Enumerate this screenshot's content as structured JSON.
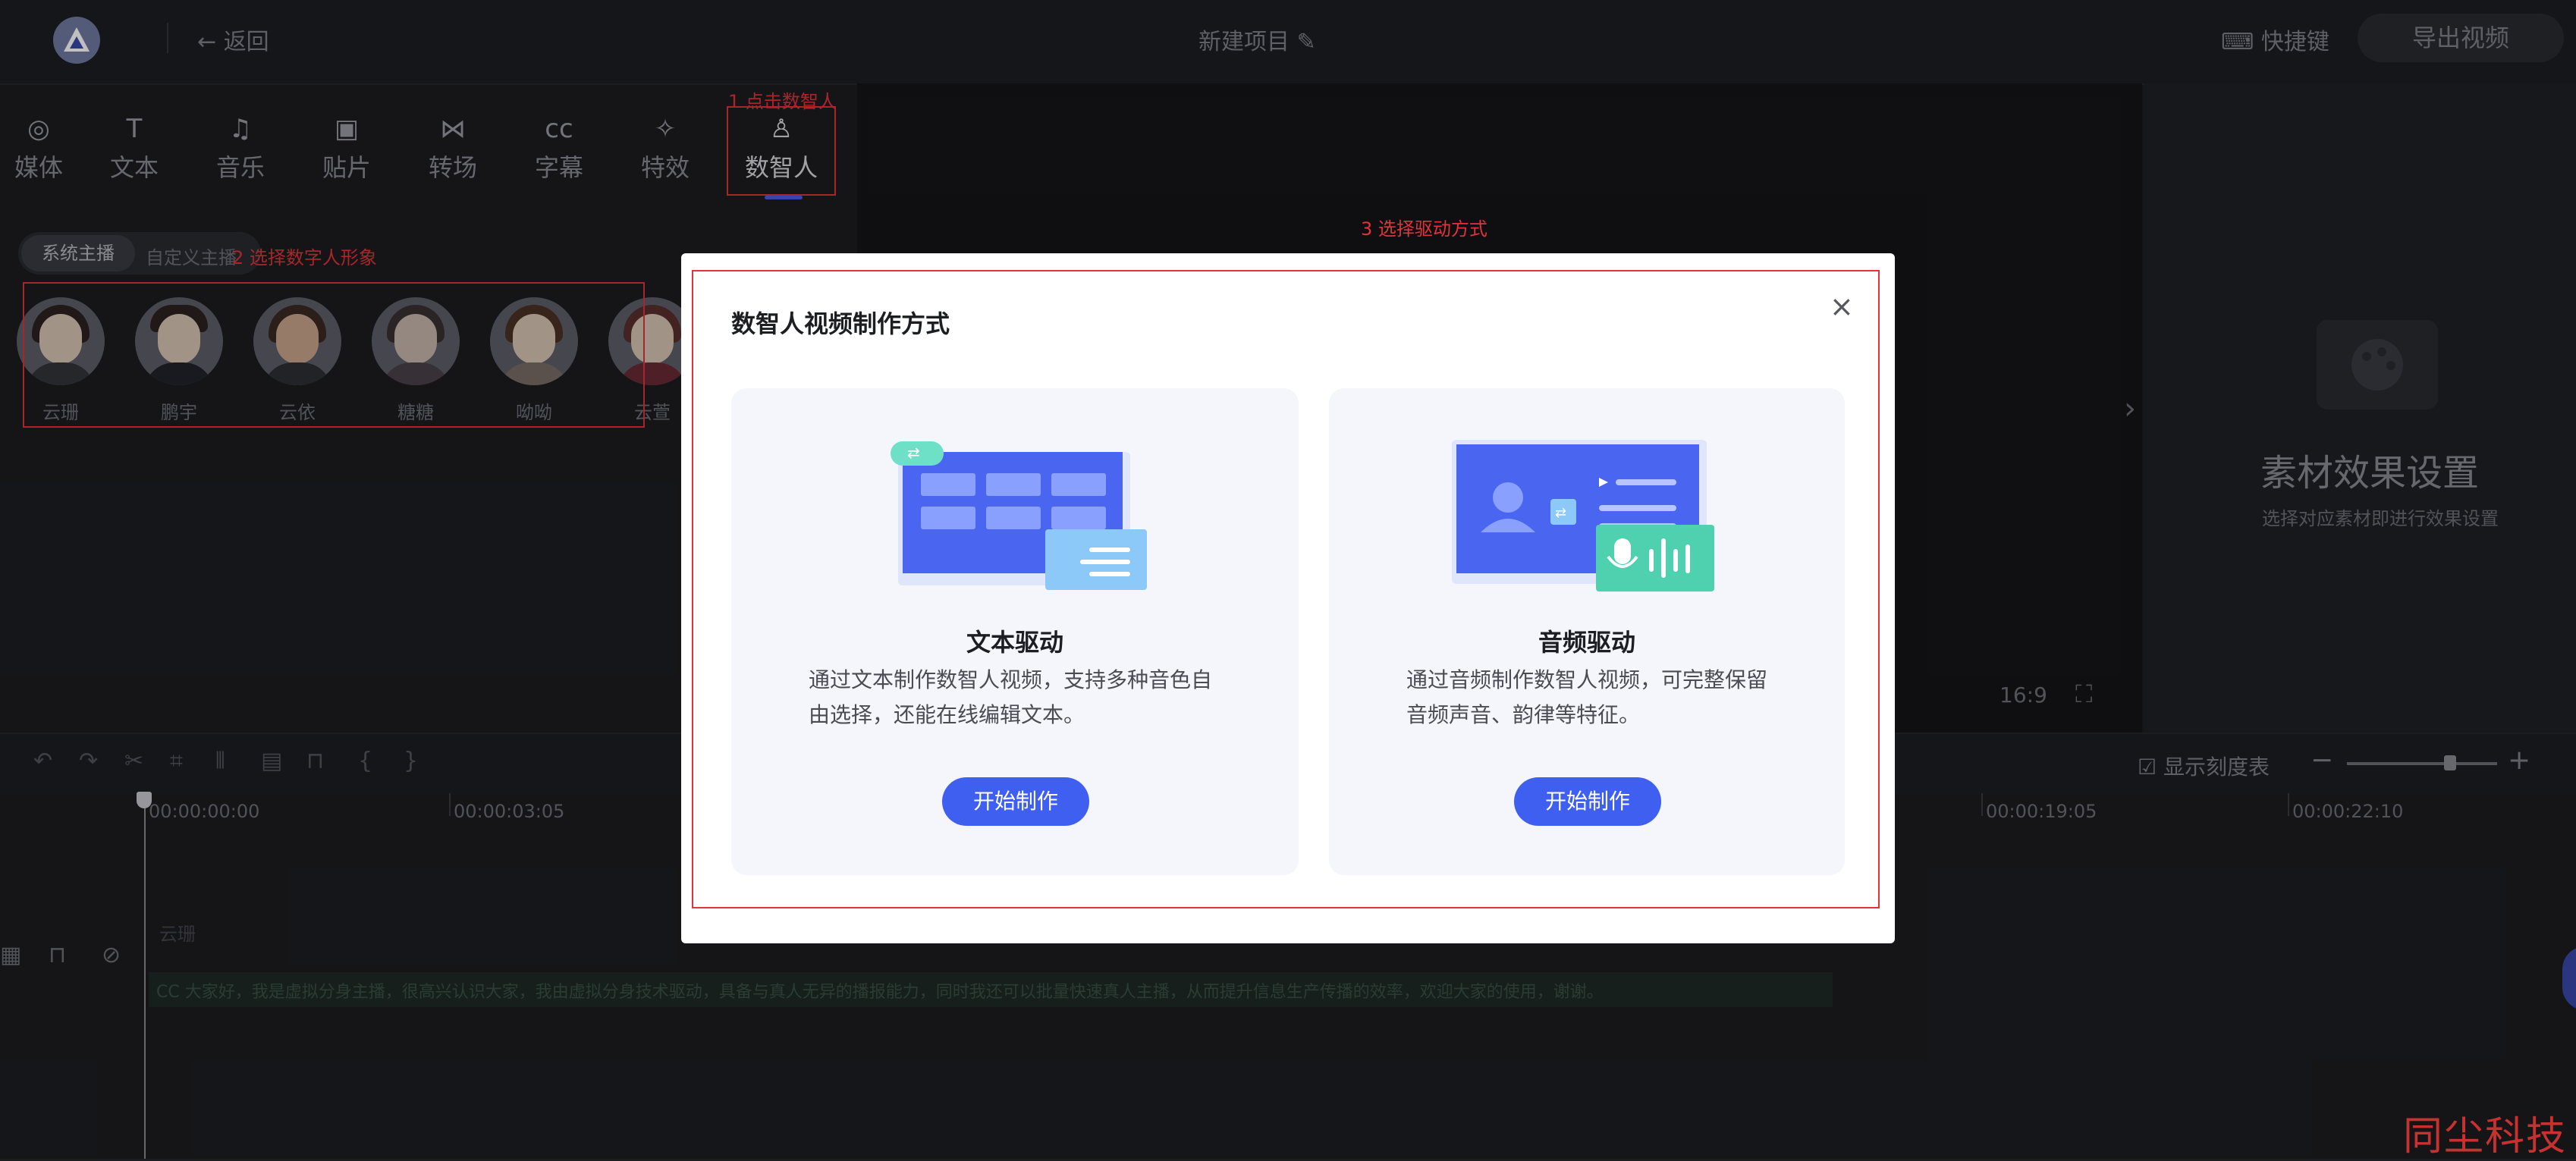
{
  "topbar": {
    "back_label": "返回",
    "project_title": "新建项目",
    "shortcut_label": "快捷键",
    "export_label": "导出视频"
  },
  "tools": [
    {
      "label": "媒体",
      "icon": "media-icon"
    },
    {
      "label": "文本",
      "icon": "text-icon"
    },
    {
      "label": "音乐",
      "icon": "music-icon"
    },
    {
      "label": "贴片",
      "icon": "sticker-icon"
    },
    {
      "label": "转场",
      "icon": "transition-icon"
    },
    {
      "label": "字幕",
      "icon": "subtitle-icon"
    },
    {
      "label": "特效",
      "icon": "effect-icon"
    },
    {
      "label": "数智人",
      "icon": "person-icon"
    }
  ],
  "annotations": {
    "step1": "1 点击数智人",
    "step2": "2 选择数字人形象",
    "step3": "3 选择驱动方式"
  },
  "subtabs": {
    "system": "系统主播",
    "custom": "自定义主播"
  },
  "avatars": [
    "云珊",
    "鹏宇",
    "云依",
    "糖糖",
    "呦呦",
    "云萱"
  ],
  "preview": {
    "ratio": "16:9"
  },
  "right_panel": {
    "title": "素材效果设置",
    "subtitle": "选择对应素材即进行效果设置"
  },
  "timeline": {
    "show_scale_label": "显示刻度表",
    "ticks": [
      "00:00:00:00",
      "00:00:03:05",
      "00:00:19:05",
      "00:00:22:10"
    ],
    "track_label": "云珊",
    "track_text": "CC 大家好，我是虚拟分身主播，很高兴认识大家，我由虚拟分身技术驱动，具备与真人无异的播报能力，同时我还可以批量快速真人主播，从而提升信息生产传播的效率，欢迎大家的使用，谢谢。"
  },
  "modal": {
    "title": "数智人视频制作方式",
    "cards": [
      {
        "title": "文本驱动",
        "desc_line1": "通过文本制作数智人视频，支持多种音色自",
        "desc_line2": "由选择，还能在线编辑文本。",
        "button": "开始制作"
      },
      {
        "title": "音频驱动",
        "desc_line1": "通过音频制作数智人视频，可完整保留",
        "desc_line2": "音频声音、韵律等特征。",
        "button": "开始制作"
      }
    ]
  },
  "watermark": "同尘科技",
  "colors": {
    "accent": "#3e5ff0",
    "annotation_red": "#e0333a",
    "background": "#1c1d21"
  }
}
